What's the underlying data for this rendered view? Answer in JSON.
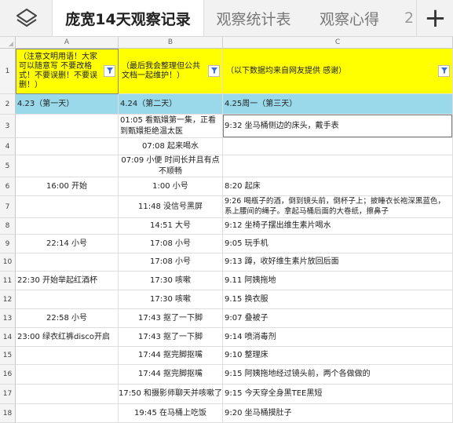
{
  "tabs": [
    {
      "label": "庞宽14天观察记录",
      "active": true
    },
    {
      "label": "观察统计表",
      "active": false
    },
    {
      "label": "观察心得",
      "active": false
    }
  ],
  "tab_more": "2",
  "add_sheet_label": "+",
  "columns": [
    "A",
    "B",
    "C"
  ],
  "header_row": {
    "num": "1",
    "a": "（注意文明用语！大家可以随意写 不要改格式！不要误删！不要误删！）",
    "b": "（最后我会整理但公共文档一起维护！）",
    "c": "（以下数据均来自网友提供 感谢）"
  },
  "date_row": {
    "num": "2",
    "a": "4.23（第一天）",
    "b": "4.24（第二天）",
    "c": "4.25周一（第三天）"
  },
  "rows": [
    {
      "num": "3",
      "a": "",
      "b": "01:05 看甄嬛第一集，正看到甄嬛拒绝温太医",
      "c": "9:32 坐马桶侧边的床头，戴手表"
    },
    {
      "num": "4",
      "a": "",
      "b": "07:08 起来喝水",
      "c": ""
    },
    {
      "num": "5",
      "a": "",
      "b": "07:09 小便 时间长并且有点不顺畅",
      "c": ""
    },
    {
      "num": "6",
      "a": "16:00 开始",
      "b": "1:00 小号",
      "c": "8:20 起床"
    },
    {
      "num": "7",
      "a": "",
      "b": "11:48 没信号黑屏",
      "c": "9:26 喝瓶子的酒，倒到镜头前，倒杯子上；披睡衣长袍深黑蓝色，系上腰间的绳子。拿起马桶后面的大卷纸，擦鼻子"
    },
    {
      "num": "8",
      "a": "",
      "b": "14:51 大号",
      "c": "9:12 坐椅子摆出维生素片喝水"
    },
    {
      "num": "9",
      "a": "22:14 小号",
      "b": "17:08 小号",
      "c": "9:05 玩手机"
    },
    {
      "num": "10",
      "a": "",
      "b": "17:08 小号",
      "c": "9:13 蹲，收好维生素片放回后面"
    },
    {
      "num": "11",
      "a": "22:30 开始举起红酒杯",
      "b": "17:30 咳嗽",
      "c": "9.11 阿姨拖地"
    },
    {
      "num": "12",
      "a": "",
      "b": "17:30 咳嗽",
      "c": "9.15 换衣服"
    },
    {
      "num": "13",
      "a": "22:58 小号",
      "b": "17:43 抠了一下脚",
      "c": "9:07 叠被子"
    },
    {
      "num": "14",
      "a": "23:00 绿衣红裤disco开启",
      "b": "17:43 抠了一下脚",
      "c": "9:14 喷消毒剂"
    },
    {
      "num": "15",
      "a": "",
      "b": "17:44 抠完脚抠嘴",
      "c": "9:10 整理床"
    },
    {
      "num": "16",
      "a": "",
      "b": "17:44 抠完脚抠嘴",
      "c": "9:15 阿姨拖地经过镜头前，两个各做做的"
    },
    {
      "num": "17",
      "a": "",
      "b": "17:50 和摄影师聊天并咳嗽了",
      "c": "9:15 今天穿全身黑TEE黑短"
    },
    {
      "num": "18",
      "a": "",
      "b": "19:45 在马桶上吃饭",
      "c": "9:20 坐马桶摸肚子"
    }
  ],
  "colors": {
    "header_yellow": "#ffff00",
    "date_blue": "#99d9ea",
    "filter_blue": "#3b6fd6"
  }
}
